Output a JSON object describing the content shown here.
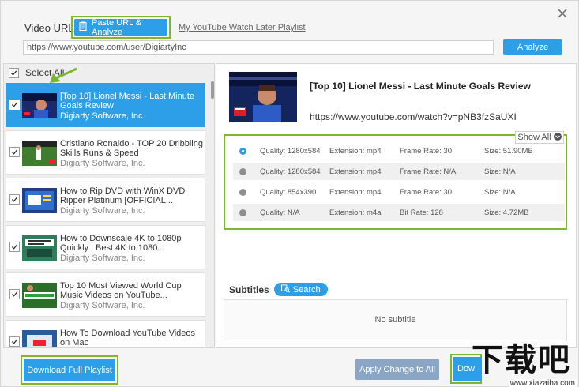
{
  "header": {
    "url_label": "Video URL:",
    "paste_button": "Paste URL & Analyze",
    "watch_later_link": "My YouTube Watch Later Playlist",
    "url_value": "https://www.youtube.com/user/DigiartyInc",
    "analyze_button": "Analyze"
  },
  "playlist": {
    "select_all": "Select All",
    "items": [
      {
        "title": "[Top 10] Lionel Messi - Last Minute Goals Review",
        "channel": "Digiarty Software, Inc.",
        "checked": true,
        "selected": true
      },
      {
        "title": "Cristiano Ronaldo - TOP 20 Dribbling Skills Runs & Speed",
        "channel": "Digiarty Software, Inc.",
        "checked": true
      },
      {
        "title": "How to Rip DVD with WinX DVD Ripper Platinum [OFFICIAL...",
        "channel": "Digiarty Software, Inc.",
        "checked": true
      },
      {
        "title": "How to Downscale 4K to 1080p Quickly | Best 4K to 1080...",
        "channel": "Digiarty Software, Inc.",
        "checked": true
      },
      {
        "title": "Top 10 Most Viewed World Cup Music Videos on YouTube...",
        "channel": "Digiarty Software, Inc.",
        "checked": true
      },
      {
        "title": "How To Download YouTube Videos on Mac",
        "channel": "",
        "checked": true
      }
    ]
  },
  "detail": {
    "title": "[Top 10] Lionel Messi - Last Minute Goals Review",
    "url": "https://www.youtube.com/watch?v=pNB3fzSaUXI",
    "show_all": "Show All",
    "formats": [
      {
        "quality": "Quality: 1280x584",
        "extension": "Extension: mp4",
        "rate": "Frame Rate: 30",
        "size": "Size: 51.90MB",
        "selected": true
      },
      {
        "quality": "Quality: 1280x584",
        "extension": "Extension: mp4",
        "rate": "Frame Rate: N/A",
        "size": "Size: N/A",
        "selected": false
      },
      {
        "quality": "Quality: 854x390",
        "extension": "Extension: mp4",
        "rate": "Frame Rate: 30",
        "size": "Size: N/A",
        "selected": false
      },
      {
        "quality": "Quality: N/A",
        "extension": "Extension: m4a",
        "rate": "Bit Rate: 128",
        "size": "Size: 4.72MB",
        "selected": false
      }
    ],
    "subtitles_label": "Subtitles",
    "search_button": "Search",
    "no_subtitle": "No subtitle"
  },
  "footer": {
    "download_playlist": "Download Full Playlist",
    "apply_change": "Apply Change to All",
    "download_now": "Dow"
  },
  "watermark": {
    "cn": "下载吧",
    "en": "www.xiazaiba.com"
  },
  "colors": {
    "accent": "#2d9ee8",
    "highlight": "#7cb82f",
    "apply_button": "#8aa6c4"
  }
}
